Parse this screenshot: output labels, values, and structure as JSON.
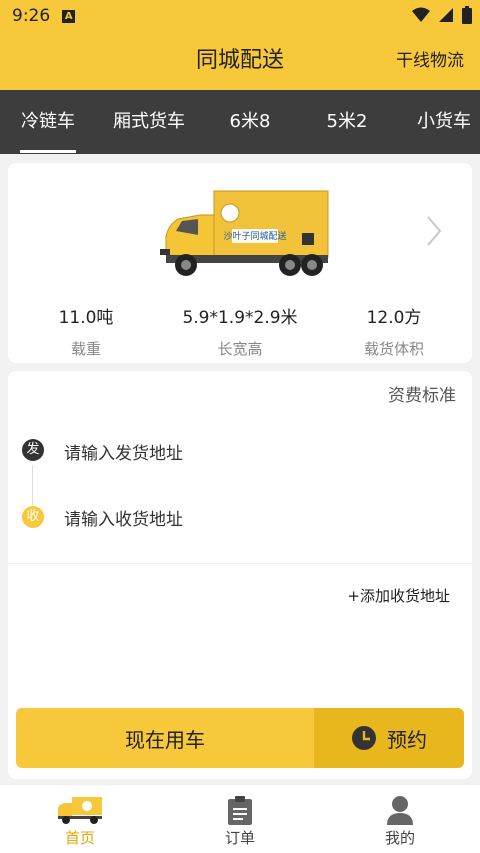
{
  "status": {
    "time": "9:26",
    "notification_letter": "A"
  },
  "header": {
    "title": "同城配送",
    "right_link": "干线物流"
  },
  "tabs": [
    {
      "label": "冷链车",
      "active": true
    },
    {
      "label": "厢式货车"
    },
    {
      "label": "6米8"
    },
    {
      "label": "5米2"
    },
    {
      "label": "小货车"
    }
  ],
  "vehicle": {
    "side_text": "沙叶子同城配送",
    "specs": [
      {
        "value": "11.0吨",
        "label": "载重"
      },
      {
        "value": "5.9*1.9*2.9米",
        "label": "长宽高"
      },
      {
        "value": "12.0方",
        "label": "载货体积"
      }
    ]
  },
  "order": {
    "fee_link": "资费标准",
    "pickup": {
      "badge": "发",
      "placeholder": "请输入发货地址"
    },
    "dropoff": {
      "badge": "收",
      "placeholder": "请输入收货地址"
    },
    "add_address": "+添加收货地址",
    "use_now": "现在用车",
    "book": "预约"
  },
  "bottom_nav": [
    {
      "label": "首页",
      "icon": "truck-icon",
      "active": true
    },
    {
      "label": "订单",
      "icon": "clipboard-icon"
    },
    {
      "label": "我的",
      "icon": "user-icon"
    }
  ],
  "colors": {
    "accent": "#f7c83a",
    "accent_dark": "#e8b61d",
    "tab_bar": "#3d3d3d",
    "active_nav": "#e3a800"
  }
}
